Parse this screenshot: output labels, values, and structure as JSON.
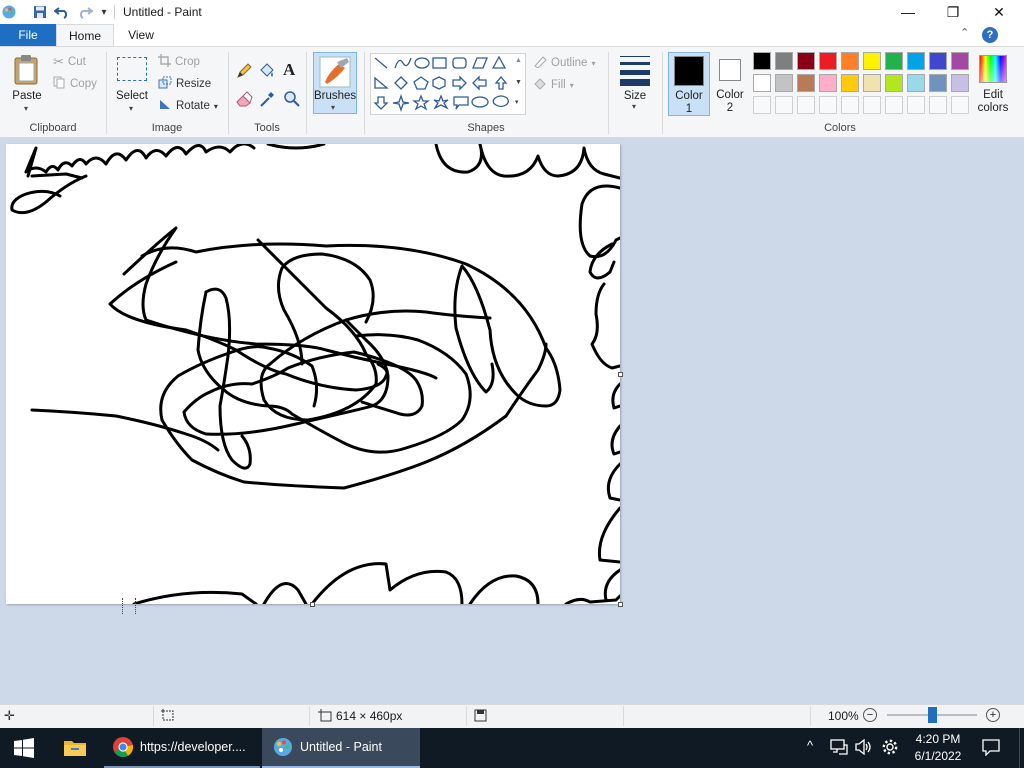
{
  "window": {
    "title": "Untitled - Paint",
    "minimize_glyph": "—",
    "maximize_glyph": "❐",
    "close_glyph": "✕"
  },
  "quick_access": {
    "save_icon": "save-icon",
    "undo_icon": "undo-icon",
    "redo_icon": "redo-icon",
    "customize_icon": "customize-dropdown-icon"
  },
  "tabs": {
    "file": "File",
    "home": "Home",
    "view": "View",
    "help": "?"
  },
  "ribbon": {
    "clipboard": {
      "group_label": "Clipboard",
      "paste": "Paste",
      "cut": "Cut",
      "copy": "Copy"
    },
    "image": {
      "group_label": "Image",
      "select": "Select",
      "crop": "Crop",
      "resize": "Resize",
      "rotate": "Rotate"
    },
    "tools": {
      "group_label": "Tools"
    },
    "brushes": {
      "label": "Brushes"
    },
    "shapes": {
      "group_label": "Shapes",
      "outline": "Outline",
      "fill": "Fill"
    },
    "size": {
      "label": "Size"
    },
    "colors": {
      "group_label": "Colors",
      "color1_label_line1": "Color",
      "color1_label_line2": "1",
      "color2_label_line1": "Color",
      "color2_label_line2": "2",
      "color1_value": "#000000",
      "color2_value": "#ffffff",
      "edit_colors_line1": "Edit",
      "edit_colors_line2": "colors",
      "palette_row1": [
        "#000000",
        "#7f7f7f",
        "#880015",
        "#ed1c24",
        "#ff7f27",
        "#fff200",
        "#22b14c",
        "#00a2e8",
        "#3f48cc",
        "#a349a4"
      ],
      "palette_row2": [
        "#ffffff",
        "#c3c3c3",
        "#b97a57",
        "#ffaec9",
        "#ffc90e",
        "#efe4b0",
        "#b5e61d",
        "#99d9ea",
        "#7092be",
        "#c8bfe7"
      ]
    }
  },
  "status": {
    "canvas_size": "614 × 460px",
    "zoom": "100%",
    "zoom_fraction": 0.5
  },
  "taskbar": {
    "chrome_label": "https://developer....",
    "paint_label": "Untitled - Paint",
    "time": "4:20 PM",
    "date": "6/1/2022"
  }
}
